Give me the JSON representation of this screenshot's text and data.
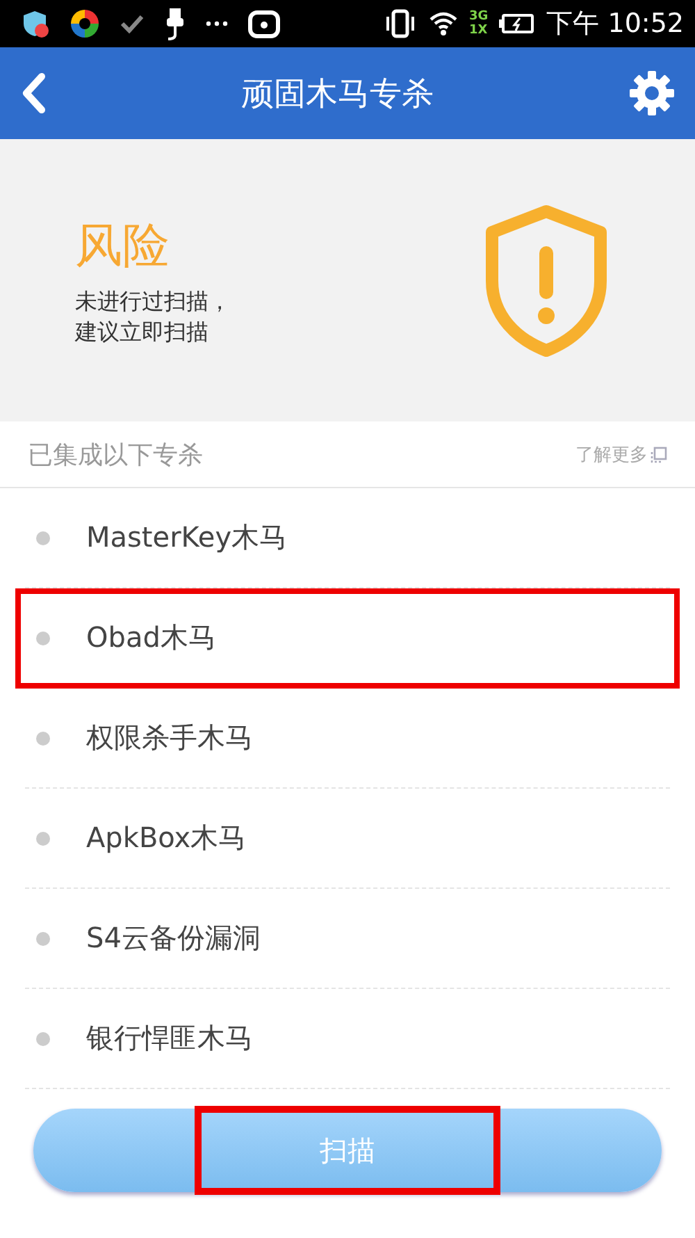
{
  "status_bar": {
    "network_labels": [
      "3G",
      "1X"
    ],
    "time": "下午 10:52"
  },
  "header": {
    "title": "顽固木马专杀"
  },
  "risk": {
    "level_label": "风险",
    "message_lines": [
      "未进行过扫描，",
      "建议立即扫描"
    ]
  },
  "section": {
    "title": "已集成以下专杀",
    "link": "了解更多"
  },
  "items": [
    {
      "label": "MasterKey木马",
      "highlighted": false
    },
    {
      "label": "Obad木马",
      "highlighted": true
    },
    {
      "label": "权限杀手木马",
      "highlighted": false
    },
    {
      "label": "ApkBox木马",
      "highlighted": false
    },
    {
      "label": "S4云备份漏洞",
      "highlighted": false
    },
    {
      "label": "银行悍匪木马",
      "highlighted": false
    }
  ],
  "scan_button": {
    "label": "扫描",
    "highlighted": true
  }
}
